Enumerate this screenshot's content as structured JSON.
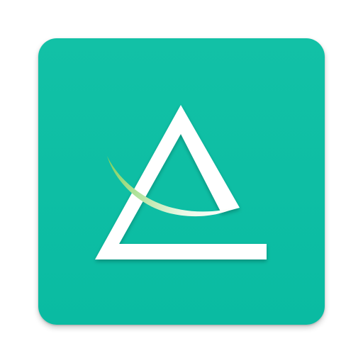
{
  "app_icon": {
    "background_color": "#0ebea4",
    "mark_color": "#ffffff",
    "swoosh_gradient": [
      "#ffffff",
      "#c8ecc0",
      "#8fd46a"
    ],
    "icon_name": "triangle-swoosh-logo-icon"
  }
}
